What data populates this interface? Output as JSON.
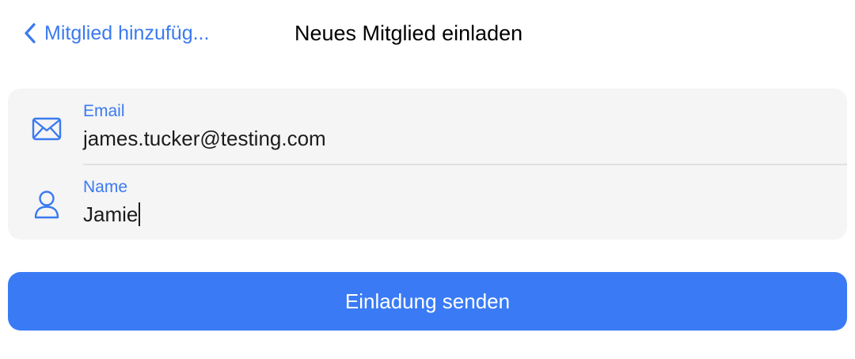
{
  "navbar": {
    "back_label": "Mitglied hinzufüg...",
    "back_icon": "chevron-left-icon",
    "title": "Neues Mitglied einladen"
  },
  "form": {
    "email": {
      "icon": "envelope-icon",
      "label": "Email",
      "value": "james.tucker@testing.com"
    },
    "name": {
      "icon": "person-icon",
      "label": "Name",
      "value": "Jamie"
    }
  },
  "actions": {
    "send_label": "Einladung senden"
  },
  "colors": {
    "accent": "#3a7af0",
    "button": "#3a7bf5",
    "card_background": "#f5f5f5",
    "text": "#1c1c1e"
  }
}
